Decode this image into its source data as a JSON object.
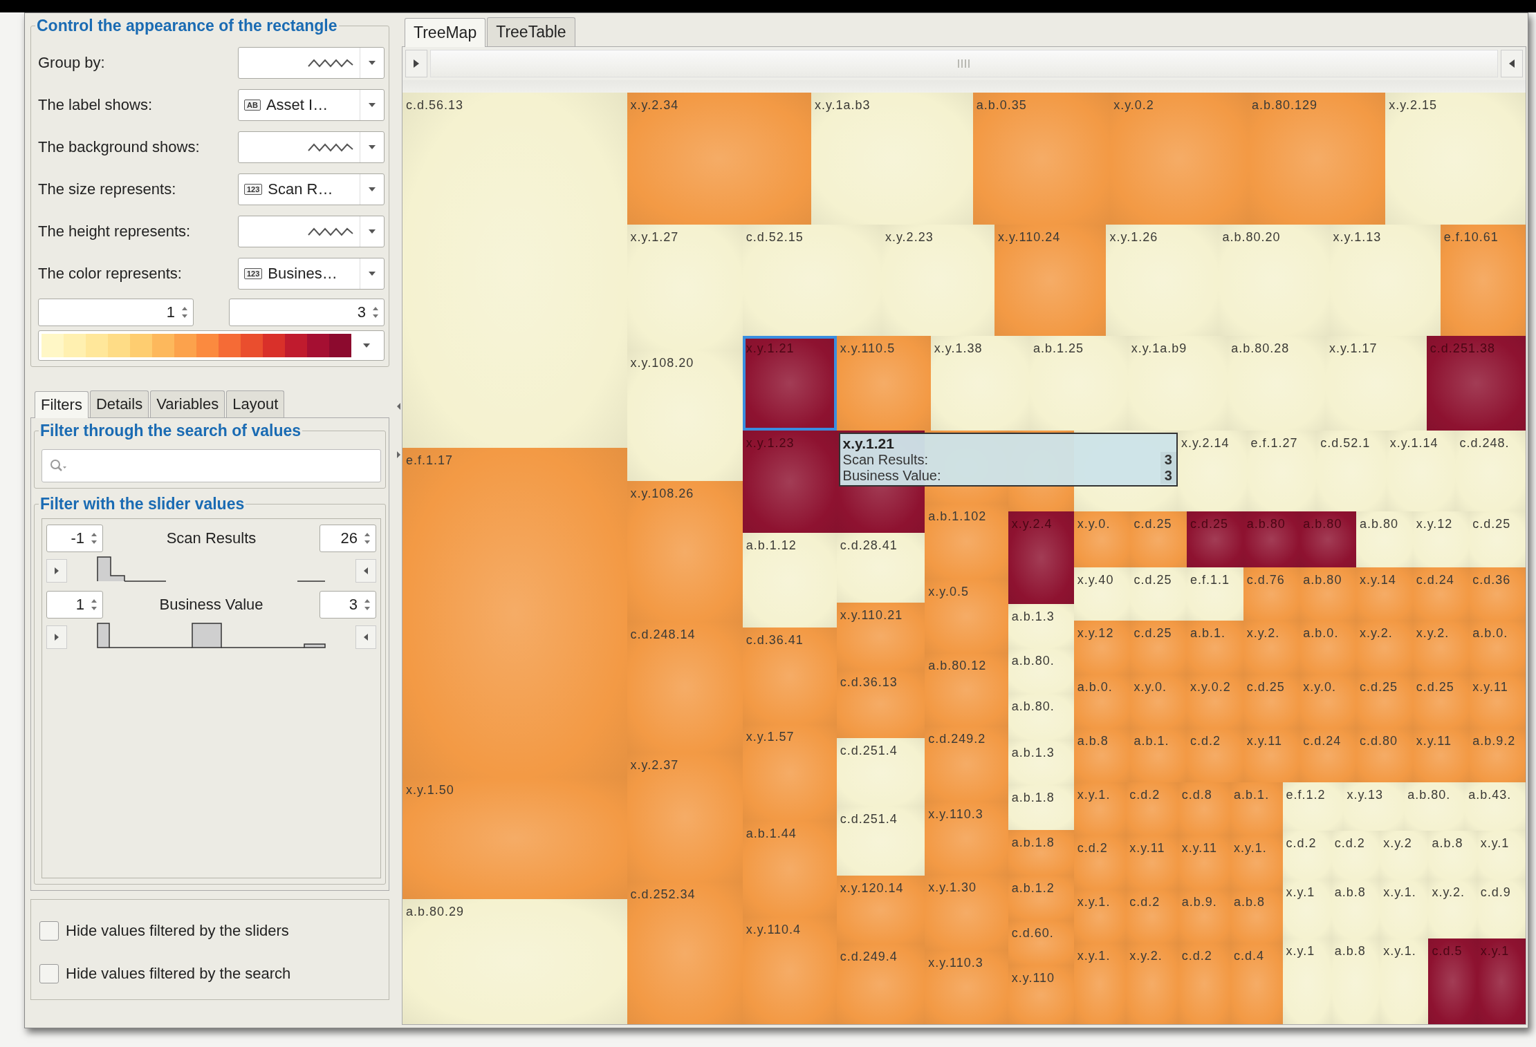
{
  "appearance": {
    "title": "Control the appearance of the rectangle",
    "rows": [
      {
        "label": "Group by:",
        "kind": "none"
      },
      {
        "label": "The label shows:",
        "kind": "field",
        "badge": "AB",
        "value": "Asset I…"
      },
      {
        "label": "The background shows:",
        "kind": "none"
      },
      {
        "label": "The size represents:",
        "kind": "field",
        "badge": "123",
        "value": "Scan R…"
      },
      {
        "label": "The height represents:",
        "kind": "none"
      },
      {
        "label": "The color represents:",
        "kind": "field",
        "badge": "123",
        "value": "Busines…"
      }
    ],
    "range_min": "1",
    "range_max": "3"
  },
  "filter_tabs": [
    {
      "label": "Filters",
      "selected": true
    },
    {
      "label": "Details",
      "selected": false
    },
    {
      "label": "Variables",
      "selected": false
    },
    {
      "label": "Layout",
      "selected": false
    }
  ],
  "search_group": {
    "title": "Filter through the search of values"
  },
  "slider_group": {
    "title": "Filter with the slider values",
    "sliders": [
      {
        "min": "-1",
        "name": "Scan Results",
        "max": "26"
      },
      {
        "min": "1",
        "name": "Business Value",
        "max": "3"
      }
    ]
  },
  "options": [
    {
      "label": "Hide values filtered by the sliders",
      "checked": false
    },
    {
      "label": "Hide values filtered by the search",
      "checked": false
    }
  ],
  "view_tabs": [
    {
      "label": "TreeMap",
      "selected": true
    },
    {
      "label": "TreeTable",
      "selected": false
    }
  ],
  "treemap": {
    "cells": [
      {
        "label": "c.d.56.13",
        "color": "#f5f2d0",
        "selected": false
      },
      {
        "label": "e.f.1.17",
        "color": "#f39a45",
        "selected": false
      },
      {
        "label": "x.y.1.50",
        "color": "#f39a45",
        "selected": false
      },
      {
        "label": "a.b.80.29",
        "color": "#f5f2d0",
        "selected": false
      },
      {
        "label": "x.y.2.34",
        "color": "#f39a45",
        "selected": false
      },
      {
        "label": "x.y.1a.b3",
        "color": "#f5f2d0",
        "selected": false
      },
      {
        "label": "a.b.0.35",
        "color": "#f39a45",
        "selected": false
      },
      {
        "label": "x.y.0.2",
        "color": "#f39a45",
        "selected": false
      },
      {
        "label": "a.b.80.129",
        "color": "#f39a45",
        "selected": false
      },
      {
        "label": "x.y.2.15",
        "color": "#f5f2d0",
        "selected": false
      },
      {
        "label": "x.y.1.27",
        "color": "#f5f2d0",
        "selected": false
      },
      {
        "label": "x.y.108.20",
        "color": "#f5f2d0",
        "selected": false
      },
      {
        "label": "x.y.108.26",
        "color": "#f39a45",
        "selected": false
      },
      {
        "label": "c.d.248.14",
        "color": "#f39a45",
        "selected": false
      },
      {
        "label": "x.y.2.37",
        "color": "#f39a45",
        "selected": false
      },
      {
        "label": "c.d.252.34",
        "color": "#f39a45",
        "selected": false
      },
      {
        "label": "c.d.52.15",
        "color": "#f5f2d0",
        "selected": false
      },
      {
        "label": "x.y.2.23",
        "color": "#f5f2d0",
        "selected": false
      },
      {
        "label": "x.y.110.24",
        "color": "#f39a45",
        "selected": false
      },
      {
        "label": "x.y.1.26",
        "color": "#f5f2d0",
        "selected": false
      },
      {
        "label": "a.b.80.20",
        "color": "#f5f2d0",
        "selected": false
      },
      {
        "label": "x.y.1.13",
        "color": "#f5f2d0",
        "selected": false
      },
      {
        "label": "e.f.10.61",
        "color": "#f39a45",
        "selected": false
      },
      {
        "label": "x.y.1.21",
        "color": "#8e1230",
        "selected": true
      },
      {
        "label": "x.y.110.5",
        "color": "#f39a45",
        "selected": false
      },
      {
        "label": "x.y.1.38",
        "color": "#f5f2d0",
        "selected": false
      },
      {
        "label": "a.b.1.25",
        "color": "#f5f2d0",
        "selected": false
      },
      {
        "label": "x.y.1a.b9",
        "color": "#f5f2d0",
        "selected": false
      },
      {
        "label": "a.b.80.28",
        "color": "#f5f2d0",
        "selected": false
      },
      {
        "label": "x.y.1.17",
        "color": "#f5f2d0",
        "selected": false
      },
      {
        "label": "c.d.251.38",
        "color": "#8e1230",
        "selected": false
      },
      {
        "label": "x.y.1.23",
        "color": "#8e1230",
        "selected": false
      },
      {
        "label": "a.b.1.12",
        "color": "#f5f2d0",
        "selected": false
      },
      {
        "label": "c.d.36.41",
        "color": "#f39a45",
        "selected": false
      },
      {
        "label": "x.y.1.57",
        "color": "#f39a45",
        "selected": false
      },
      {
        "label": "a.b.1.44",
        "color": "#f39a45",
        "selected": false
      },
      {
        "label": "x.y.110.4",
        "color": "#f39a45",
        "selected": false
      },
      {
        "color": "#8e1230",
        "selected": false
      },
      {
        "label": "c.d.28.41",
        "color": "#f5f2d0",
        "selected": false
      },
      {
        "label": "x.y.110.21",
        "color": "#f39a45",
        "selected": false
      },
      {
        "label": "c.d.36.13",
        "color": "#f39a45",
        "selected": false
      },
      {
        "label": "c.d.251.4",
        "color": "#f5f2d0",
        "selected": false
      },
      {
        "label": "c.d.251.4",
        "color": "#f5f2d0",
        "selected": false
      },
      {
        "label": "x.y.120.14",
        "color": "#f39a45",
        "selected": false
      },
      {
        "label": "c.d.249.4",
        "color": "#f39a45",
        "selected": false
      },
      {
        "color": "#f39a45",
        "selected": false
      },
      {
        "label": "a.b.1.102",
        "color": "#f39a45",
        "selected": false
      },
      {
        "label": "x.y.0.5",
        "color": "#f39a45",
        "selected": false
      },
      {
        "label": "a.b.80.12",
        "color": "#f39a45",
        "selected": false
      },
      {
        "label": "c.d.249.2",
        "color": "#f39a45",
        "selected": false
      },
      {
        "label": "x.y.110.3",
        "color": "#f39a45",
        "selected": false
      },
      {
        "label": "x.y.1.30",
        "color": "#f39a45",
        "selected": false
      },
      {
        "label": "x.y.110.3",
        "color": "#f39a45",
        "selected": false
      },
      {
        "color": "#f39a45",
        "selected": false
      },
      {
        "label": "x.y.2.4",
        "color": "#8e1230",
        "selected": false
      },
      {
        "label": "a.b.1.3",
        "color": "#f5f2d0",
        "selected": false
      },
      {
        "label": "a.b.80.",
        "color": "#f5f2d0",
        "selected": false
      },
      {
        "label": "a.b.80.",
        "color": "#f5f2d0",
        "selected": false
      },
      {
        "label": "a.b.1.3",
        "color": "#f5f2d0",
        "selected": false
      },
      {
        "label": "a.b.1.8",
        "color": "#f5f2d0",
        "selected": false
      },
      {
        "label": "a.b.1.8",
        "color": "#f39a45",
        "selected": false
      },
      {
        "label": "a.b.1.2",
        "color": "#f39a45",
        "selected": false
      },
      {
        "label": "c.d.60.",
        "color": "#f39a45",
        "selected": false
      },
      {
        "label": "x.y.110",
        "color": "#f39a45",
        "selected": false
      },
      {
        "color": "#f5f2d0",
        "selected": false
      },
      {
        "label": "x.y.2.14",
        "color": "#f5f2d0",
        "selected": false
      },
      {
        "label": "e.f.1.27",
        "color": "#f5f2d0",
        "selected": false
      },
      {
        "label": "c.d.52.1",
        "color": "#f5f2d0",
        "selected": false
      },
      {
        "label": "x.y.1.14",
        "color": "#f5f2d0",
        "selected": false
      },
      {
        "label": "c.d.248.",
        "color": "#f5f2d0",
        "selected": false
      },
      {
        "label": "x.y.0.",
        "color": "#f39a45",
        "selected": false
      },
      {
        "label": "c.d.25",
        "color": "#f39a45",
        "selected": false
      },
      {
        "label": "c.d.25",
        "color": "#8e1230",
        "selected": false
      },
      {
        "label": "a.b.80",
        "color": "#8e1230",
        "selected": false
      },
      {
        "label": "a.b.80",
        "color": "#8e1230",
        "selected": false
      },
      {
        "label": "a.b.80",
        "color": "#f5f2d0",
        "selected": false
      },
      {
        "label": "x.y.12",
        "color": "#f5f2d0",
        "selected": false
      },
      {
        "label": "c.d.25",
        "color": "#f5f2d0",
        "selected": false
      },
      {
        "label": "x.y.40",
        "color": "#f5f2d0",
        "selected": false
      },
      {
        "label": "c.d.25",
        "color": "#f5f2d0",
        "selected": false
      },
      {
        "label": "e.f.1.1",
        "color": "#f5f2d0",
        "selected": false
      },
      {
        "label": "c.d.76",
        "color": "#f39a45",
        "selected": false
      },
      {
        "label": "a.b.80",
        "color": "#f39a45",
        "selected": false
      },
      {
        "label": "x.y.14",
        "color": "#f39a45",
        "selected": false
      },
      {
        "label": "c.d.24",
        "color": "#f39a45",
        "selected": false
      },
      {
        "label": "c.d.36",
        "color": "#f39a45",
        "selected": false
      },
      {
        "label": "x.y.12",
        "color": "#f39a45",
        "selected": false
      },
      {
        "label": "c.d.25",
        "color": "#f39a45",
        "selected": false
      },
      {
        "label": "a.b.1.",
        "color": "#f39a45",
        "selected": false
      },
      {
        "label": "x.y.2.",
        "color": "#f39a45",
        "selected": false
      },
      {
        "label": "a.b.0.",
        "color": "#f39a45",
        "selected": false
      },
      {
        "label": "x.y.2.",
        "color": "#f39a45",
        "selected": false
      },
      {
        "label": "x.y.2.",
        "color": "#f39a45",
        "selected": false
      },
      {
        "label": "a.b.0.",
        "color": "#f39a45",
        "selected": false
      },
      {
        "label": "a.b.0.",
        "color": "#f39a45",
        "selected": false
      },
      {
        "label": "x.y.0.",
        "color": "#f39a45",
        "selected": false
      },
      {
        "label": "x.y.0.2",
        "color": "#f39a45",
        "selected": false
      },
      {
        "label": "c.d.25",
        "color": "#f39a45",
        "selected": false
      },
      {
        "label": "x.y.0.",
        "color": "#f39a45",
        "selected": false
      },
      {
        "label": "c.d.25",
        "color": "#f39a45",
        "selected": false
      },
      {
        "label": "c.d.25",
        "color": "#f39a45",
        "selected": false
      },
      {
        "label": "x.y.11",
        "color": "#f39a45",
        "selected": false
      },
      {
        "label": "a.b.8",
        "color": "#f39a45",
        "selected": false
      },
      {
        "label": "a.b.1.",
        "color": "#f39a45",
        "selected": false
      },
      {
        "label": "c.d.2",
        "color": "#f39a45",
        "selected": false
      },
      {
        "label": "x.y.11",
        "color": "#f39a45",
        "selected": false
      },
      {
        "label": "c.d.24",
        "color": "#f39a45",
        "selected": false
      },
      {
        "label": "c.d.80",
        "color": "#f39a45",
        "selected": false
      },
      {
        "label": "x.y.11",
        "color": "#f39a45",
        "selected": false
      },
      {
        "label": "a.b.9.2",
        "color": "#f39a45",
        "selected": false
      },
      {
        "label": "x.y.1.",
        "color": "#f39a45",
        "selected": false
      },
      {
        "label": "c.d.2",
        "color": "#f39a45",
        "selected": false
      },
      {
        "label": "c.d.8",
        "color": "#f39a45",
        "selected": false
      },
      {
        "label": "a.b.1.",
        "color": "#f39a45",
        "selected": false
      },
      {
        "label": "c.d.2",
        "color": "#f39a45",
        "selected": false
      },
      {
        "label": "x.y.11",
        "color": "#f39a45",
        "selected": false
      },
      {
        "label": "x.y.11",
        "color": "#f39a45",
        "selected": false
      },
      {
        "label": "x.y.1.",
        "color": "#f39a45",
        "selected": false
      },
      {
        "label": "x.y.1.",
        "color": "#f39a45",
        "selected": false
      },
      {
        "label": "c.d.2",
        "color": "#f39a45",
        "selected": false
      },
      {
        "label": "a.b.9.",
        "color": "#f39a45",
        "selected": false
      },
      {
        "label": "a.b.8",
        "color": "#f39a45",
        "selected": false
      },
      {
        "label": "x.y.1.",
        "color": "#f39a45",
        "selected": false
      },
      {
        "label": "x.y.2.",
        "color": "#f39a45",
        "selected": false
      },
      {
        "label": "c.d.2",
        "color": "#f39a45",
        "selected": false
      },
      {
        "label": "c.d.4",
        "color": "#f39a45",
        "selected": false
      },
      {
        "label": "e.f.1.2",
        "color": "#f5f2d0",
        "selected": false
      },
      {
        "label": "x.y.13",
        "color": "#f5f2d0",
        "selected": false
      },
      {
        "label": "a.b.80.",
        "color": "#f5f2d0",
        "selected": false
      },
      {
        "label": "a.b.43.",
        "color": "#f5f2d0",
        "selected": false
      },
      {
        "label": "c.d.2",
        "color": "#f5f2d0",
        "selected": false
      },
      {
        "label": "c.d.2",
        "color": "#f5f2d0",
        "selected": false
      },
      {
        "label": "x.y.2",
        "color": "#f5f2d0",
        "selected": false
      },
      {
        "label": "a.b.8",
        "color": "#f5f2d0",
        "selected": false
      },
      {
        "label": "x.y.1",
        "color": "#f5f2d0",
        "selected": false
      },
      {
        "label": "x.y.1",
        "color": "#f5f2d0",
        "selected": false
      },
      {
        "label": "a.b.8",
        "color": "#f5f2d0",
        "selected": false
      },
      {
        "label": "x.y.1.",
        "color": "#f5f2d0",
        "selected": false
      },
      {
        "label": "x.y.2.",
        "color": "#f5f2d0",
        "selected": false
      },
      {
        "label": "c.d.9",
        "color": "#f5f2d0",
        "selected": false
      },
      {
        "label": "x.y.1",
        "color": "#f5f2d0",
        "selected": false
      },
      {
        "label": "a.b.8",
        "color": "#f5f2d0",
        "selected": false
      },
      {
        "label": "x.y.1.",
        "color": "#f5f2d0",
        "selected": false
      },
      {
        "label": "c.d.5",
        "color": "#8e1230",
        "selected": false
      },
      {
        "label": "x.y.1",
        "color": "#8e1230",
        "selected": false
      }
    ],
    "tooltip": {
      "title": "x.y.1.21",
      "rows": [
        {
          "label": "Scan Results:",
          "value": "3"
        },
        {
          "label": "Business Value:",
          "value": "3"
        }
      ]
    }
  }
}
